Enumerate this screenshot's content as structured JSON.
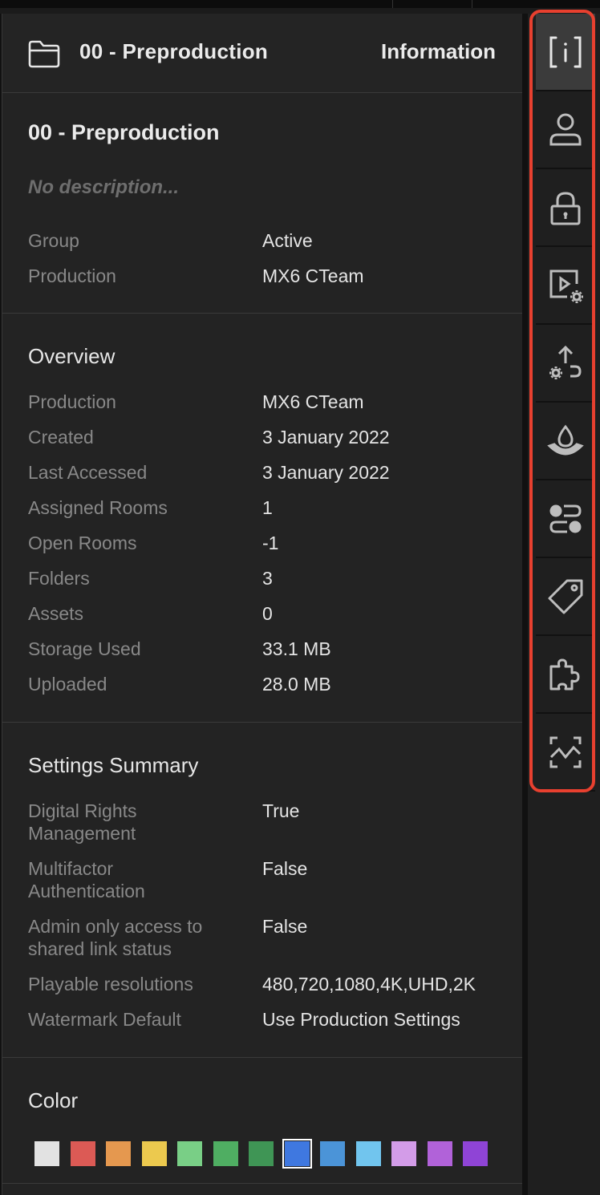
{
  "header": {
    "title": "00 - Preproduction",
    "right_label": "Information"
  },
  "project": {
    "name": "00 - Preproduction",
    "description": "No description...",
    "rows": [
      {
        "label": "Group",
        "value": "Active"
      },
      {
        "label": "Production",
        "value": "MX6 CTeam"
      }
    ]
  },
  "overview": {
    "title": "Overview",
    "rows": [
      {
        "label": "Production",
        "value": "MX6 CTeam"
      },
      {
        "label": "Created",
        "value": "3 January 2022"
      },
      {
        "label": "Last Accessed",
        "value": "3 January 2022"
      },
      {
        "label": "Assigned Rooms",
        "value": "1"
      },
      {
        "label": "Open Rooms",
        "value": "-1"
      },
      {
        "label": "Folders",
        "value": "3"
      },
      {
        "label": "Assets",
        "value": "0"
      },
      {
        "label": "Storage Used",
        "value": "33.1 MB"
      },
      {
        "label": "Uploaded",
        "value": "28.0 MB"
      }
    ]
  },
  "settings": {
    "title": "Settings Summary",
    "rows": [
      {
        "label": "Digital Rights Management",
        "value": "True"
      },
      {
        "label": "Multifactor Authentication",
        "value": "False"
      },
      {
        "label": "Admin only access to shared link status",
        "value": "False"
      },
      {
        "label": "Playable resolutions",
        "value": "480,720,1080,4K,UHD,2K"
      },
      {
        "label": "Watermark Default",
        "value": "Use Production Settings"
      }
    ]
  },
  "color": {
    "title": "Color",
    "swatches": [
      "#e2e2e2",
      "#dc5a55",
      "#e5984f",
      "#ecc94e",
      "#79cf86",
      "#4fae62",
      "#3f9555",
      "#3f78e0",
      "#4b94d8",
      "#71c5ee",
      "#d39ce8",
      "#b162d9",
      "#8f44d6"
    ],
    "selected_index": 7
  },
  "rail": {
    "items": [
      "info-icon",
      "user-icon",
      "lock-icon",
      "video-settings-icon",
      "upload-settings-icon",
      "watermark-icon",
      "toggles-icon",
      "tag-icon",
      "puzzle-icon",
      "activity-icon"
    ],
    "active_index": 0,
    "outline_color": "#e8402f"
  }
}
